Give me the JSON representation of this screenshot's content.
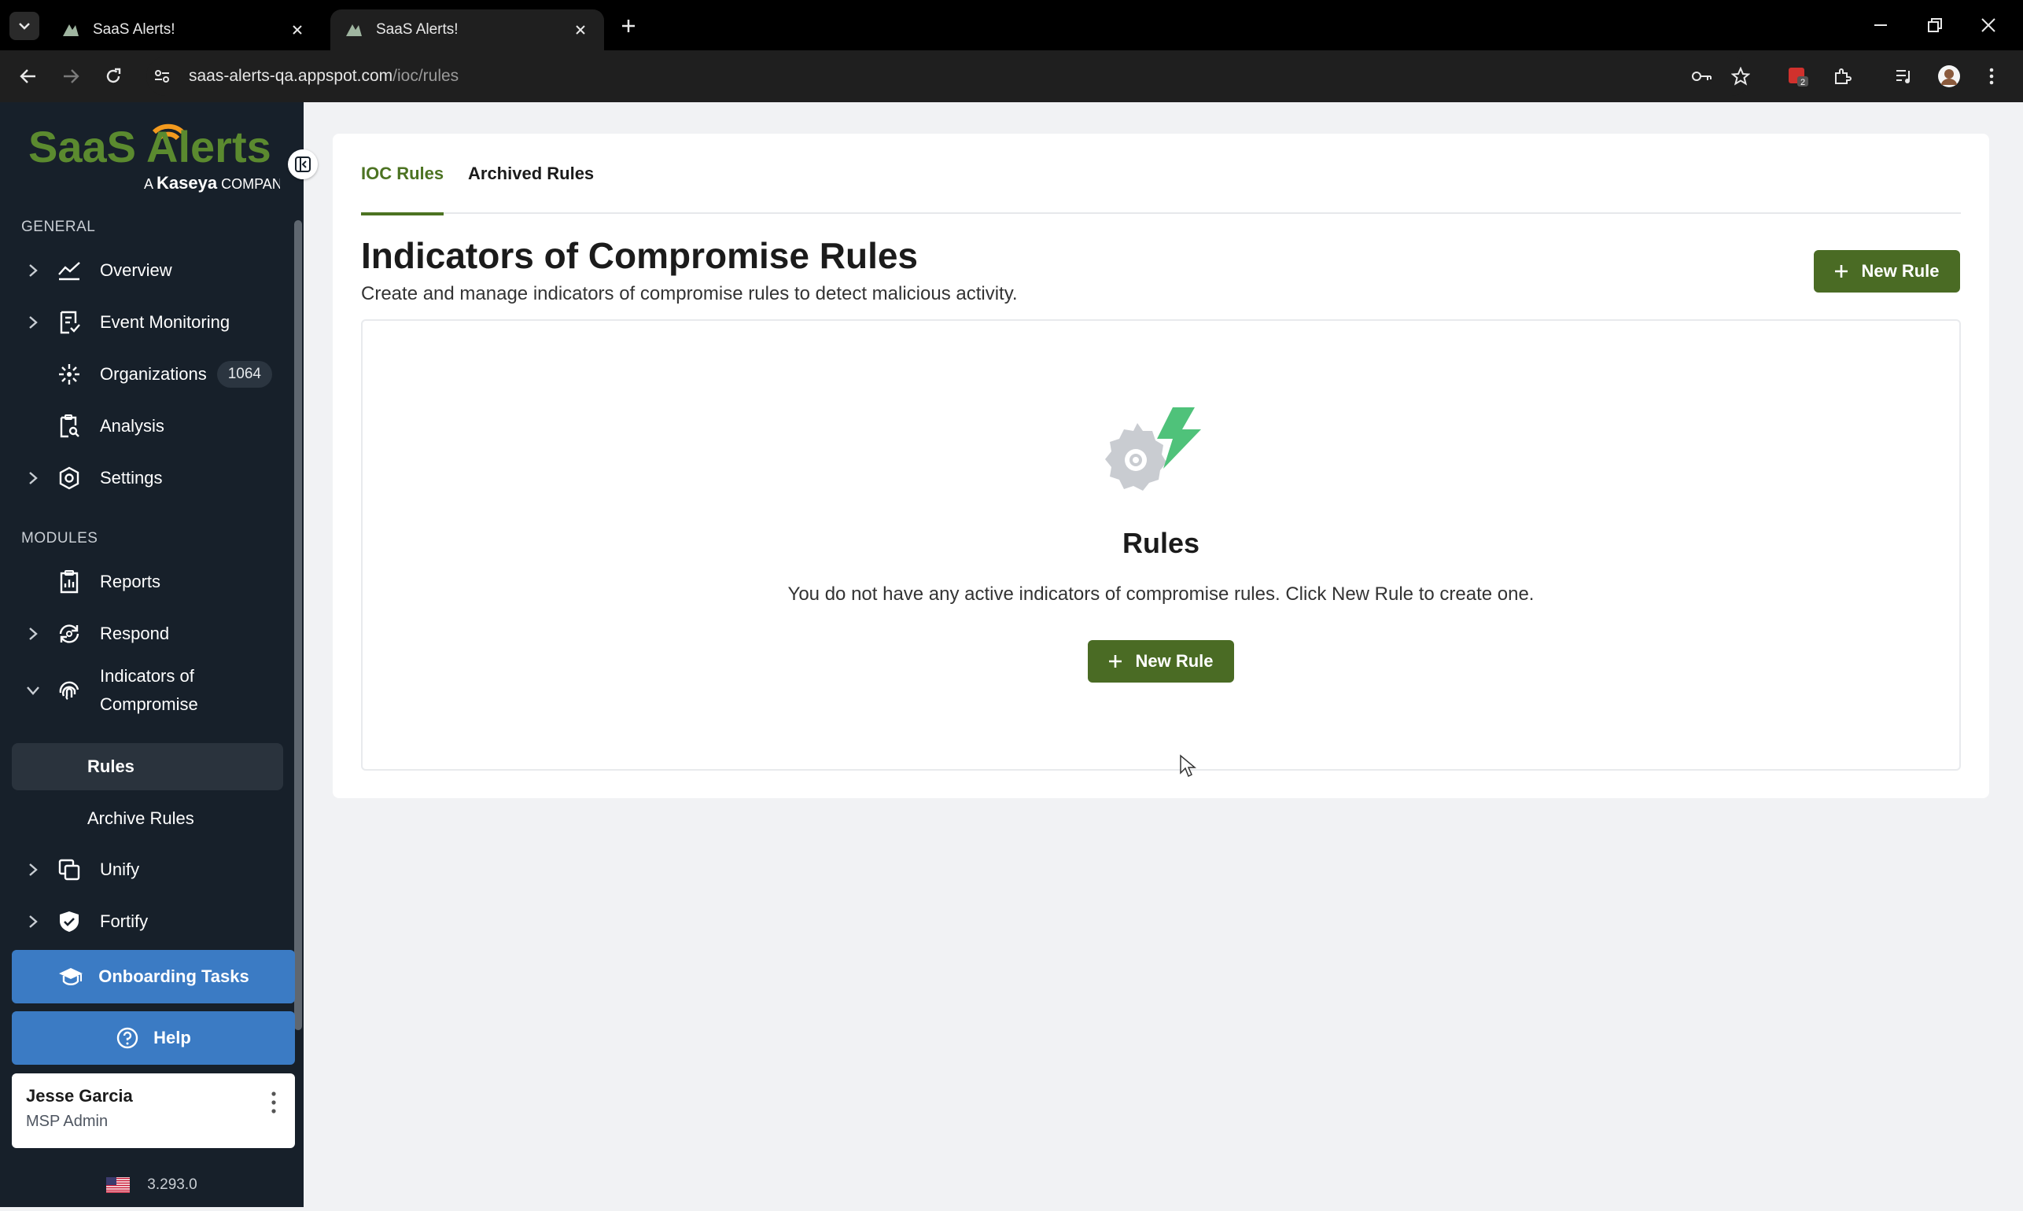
{
  "browser": {
    "tabs": [
      {
        "title": "SaaS Alerts!",
        "active": false
      },
      {
        "title": "SaaS Alerts!",
        "active": true
      }
    ],
    "url_host": "saas-alerts-qa.appspot.com",
    "url_path": "/ioc/rules",
    "extension_badge": "2"
  },
  "sidebar": {
    "logo": {
      "brand": "SaaS Alerts",
      "tagline_prefix": "A",
      "tagline_brand": "Kaseya",
      "tagline_suffix": "COMPANY"
    },
    "general_label": "GENERAL",
    "modules_label": "MODULES",
    "items": {
      "overview": "Overview",
      "event_monitoring": "Event Monitoring",
      "organizations": "Organizations",
      "organizations_count": "1064",
      "analysis": "Analysis",
      "settings": "Settings",
      "reports": "Reports",
      "respond": "Respond",
      "ioc_line1": "Indicators of",
      "ioc_line2": "Compromise",
      "rules": "Rules",
      "archive_rules": "Archive Rules",
      "unify": "Unify",
      "fortify": "Fortify"
    },
    "onboarding_label": "Onboarding Tasks",
    "help_label": "Help",
    "user": {
      "name": "Jesse Garcia",
      "role": "MSP Admin"
    },
    "version": "3.293.0"
  },
  "main": {
    "tabs": [
      "IOC Rules",
      "Archived Rules"
    ],
    "title": "Indicators of Compromise Rules",
    "subtitle": "Create and manage indicators of compromise rules to detect malicious activity.",
    "new_rule_label": "New Rule",
    "empty": {
      "title": "Rules",
      "text": "You do not have any active indicators of compromise rules. Click New Rule to create one.",
      "button_label": "New Rule"
    }
  },
  "colors": {
    "sidebar_bg": "#17202a",
    "accent_green": "#4a6b24",
    "tab_active_green": "#4c7322",
    "help_blue": "#3b7bc4",
    "logo_green": "#5b8a2f",
    "logo_orange": "#f39a1e"
  }
}
